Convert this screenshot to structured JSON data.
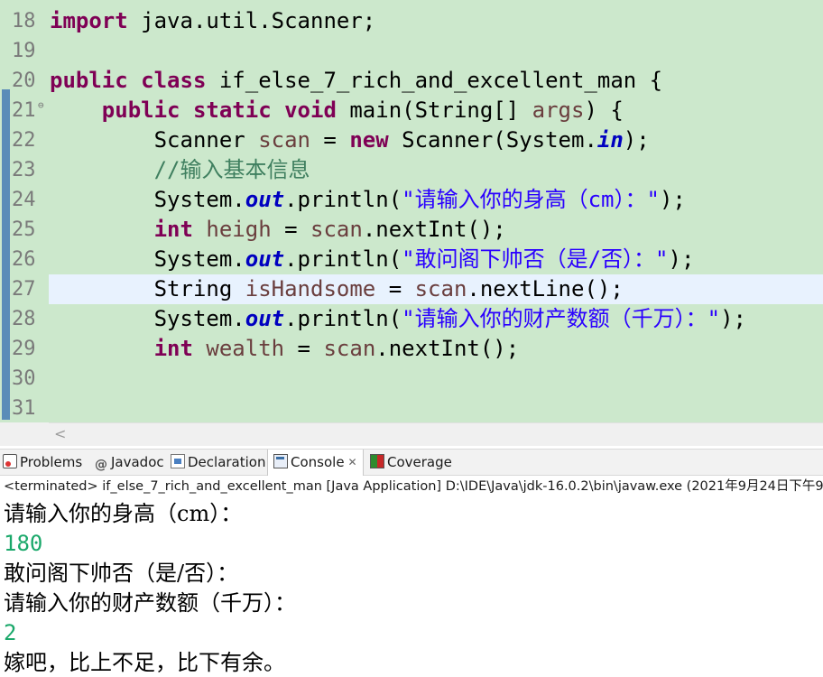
{
  "editor": {
    "lines": [
      {
        "num": "18",
        "tokens": [
          {
            "t": "import",
            "c": "kw"
          },
          {
            "t": " java.util.Scanner;",
            "c": "plain"
          }
        ]
      },
      {
        "num": "19",
        "tokens": []
      },
      {
        "num": "20",
        "tokens": [
          {
            "t": "public",
            "c": "kw"
          },
          {
            "t": " ",
            "c": "plain"
          },
          {
            "t": "class",
            "c": "kw"
          },
          {
            "t": " if_else_7_rich_and_excellent_man {",
            "c": "plain"
          }
        ]
      },
      {
        "num": "21",
        "fold": "⊖",
        "tokens": [
          {
            "t": "    ",
            "c": "plain"
          },
          {
            "t": "public",
            "c": "kw"
          },
          {
            "t": " ",
            "c": "plain"
          },
          {
            "t": "static",
            "c": "kw"
          },
          {
            "t": " ",
            "c": "plain"
          },
          {
            "t": "void",
            "c": "kw"
          },
          {
            "t": " main(String[] ",
            "c": "plain"
          },
          {
            "t": "args",
            "c": "var"
          },
          {
            "t": ") {",
            "c": "plain"
          }
        ]
      },
      {
        "num": "22",
        "tokens": [
          {
            "t": "        Scanner ",
            "c": "plain"
          },
          {
            "t": "scan",
            "c": "var"
          },
          {
            "t": " = ",
            "c": "plain"
          },
          {
            "t": "new",
            "c": "kw"
          },
          {
            "t": " Scanner(System.",
            "c": "plain"
          },
          {
            "t": "in",
            "c": "fld"
          },
          {
            "t": ");",
            "c": "plain"
          }
        ]
      },
      {
        "num": "23",
        "tokens": [
          {
            "t": "        ",
            "c": "plain"
          },
          {
            "t": "//输入基本信息",
            "c": "cmt"
          }
        ]
      },
      {
        "num": "24",
        "tokens": [
          {
            "t": "        System.",
            "c": "plain"
          },
          {
            "t": "out",
            "c": "fld"
          },
          {
            "t": ".println(",
            "c": "plain"
          },
          {
            "t": "\"请输入你的身高（cm）：\"",
            "c": "str"
          },
          {
            "t": ");",
            "c": "plain"
          }
        ]
      },
      {
        "num": "25",
        "tokens": [
          {
            "t": "        ",
            "c": "plain"
          },
          {
            "t": "int",
            "c": "kw"
          },
          {
            "t": " ",
            "c": "plain"
          },
          {
            "t": "heigh",
            "c": "var"
          },
          {
            "t": " = ",
            "c": "plain"
          },
          {
            "t": "scan",
            "c": "var"
          },
          {
            "t": ".nextInt();",
            "c": "plain"
          }
        ]
      },
      {
        "num": "26",
        "tokens": [
          {
            "t": "        System.",
            "c": "plain"
          },
          {
            "t": "out",
            "c": "fld"
          },
          {
            "t": ".println(",
            "c": "plain"
          },
          {
            "t": "\"敢问阁下帅否（是/否）：\"",
            "c": "str"
          },
          {
            "t": ");",
            "c": "plain"
          }
        ]
      },
      {
        "num": "27",
        "current": true,
        "tokens": [
          {
            "t": "        String ",
            "c": "plain"
          },
          {
            "t": "isHandsome",
            "c": "var"
          },
          {
            "t": " = ",
            "c": "plain"
          },
          {
            "t": "scan",
            "c": "var"
          },
          {
            "t": ".nextLine();",
            "c": "plain"
          }
        ]
      },
      {
        "num": "28",
        "tokens": [
          {
            "t": "        System.",
            "c": "plain"
          },
          {
            "t": "out",
            "c": "fld"
          },
          {
            "t": ".println(",
            "c": "plain"
          },
          {
            "t": "\"请输入你的财产数额（千万）：\"",
            "c": "str"
          },
          {
            "t": ");",
            "c": "plain"
          }
        ]
      },
      {
        "num": "29",
        "tokens": [
          {
            "t": "        ",
            "c": "plain"
          },
          {
            "t": "int",
            "c": "kw"
          },
          {
            "t": " ",
            "c": "plain"
          },
          {
            "t": "wealth",
            "c": "var"
          },
          {
            "t": " = ",
            "c": "plain"
          },
          {
            "t": "scan",
            "c": "var"
          },
          {
            "t": ".nextInt();",
            "c": "plain"
          }
        ]
      },
      {
        "num": "30",
        "tokens": []
      },
      {
        "num": "31",
        "tokens": []
      }
    ],
    "scroll_left_glyph": "<"
  },
  "views": {
    "tabs": [
      {
        "label": "Problems",
        "icon": "problems-icon",
        "active": false
      },
      {
        "label": "Javadoc",
        "icon": "javadoc-icon",
        "active": false
      },
      {
        "label": "Declaration",
        "icon": "declaration-icon",
        "active": false
      },
      {
        "label": "Console",
        "icon": "console-icon",
        "active": true,
        "close": "✕"
      },
      {
        "label": "Coverage",
        "icon": "coverage-icon",
        "active": false
      }
    ]
  },
  "console": {
    "status": "<terminated> if_else_7_rich_and_excellent_man [Java Application] D:\\IDE\\Java\\jdk-16.0.2\\bin\\javaw.exe  (2021年9月24日下午9:",
    "lines": [
      {
        "text": "请输入你的身高（cm）：",
        "kind": "out"
      },
      {
        "text": "180",
        "kind": "in"
      },
      {
        "text": "敢问阁下帅否（是/否）：",
        "kind": "out"
      },
      {
        "text": "请输入你的财产数额（千万）：",
        "kind": "out"
      },
      {
        "text": "2",
        "kind": "in"
      },
      {
        "text": "嫁吧，比上不足，比下有余。",
        "kind": "out"
      }
    ]
  },
  "colors": {
    "editor_bg": "#cce8cc",
    "keyword": "#7f0055",
    "string": "#2a00ff",
    "comment": "#3f7f5f",
    "field": "#0000c0",
    "variable": "#6a3e3e",
    "console_input": "#1aa86a"
  }
}
